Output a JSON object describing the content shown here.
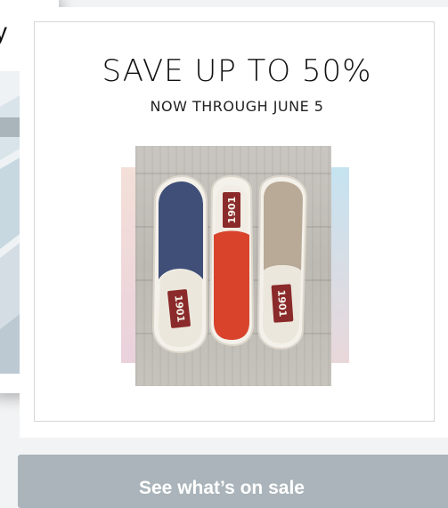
{
  "carousel": {
    "prev_card": {
      "text_fragment": "y"
    },
    "promo": {
      "headline": "SAVE UP TO 50%",
      "subhead": "NOW THROUGH JUNE 5",
      "image": {
        "subject": "three slip-on sneakers",
        "brand_mark": "1901",
        "shoe_colors": [
          "#3f4f78",
          "#d9432c",
          "#b8aa96"
        ]
      }
    }
  },
  "cta": {
    "label": "See what’s on sale"
  },
  "colors": {
    "page_background": "#f2f3f4",
    "card_background": "#ffffff",
    "cta_background": "#aab4ba",
    "cta_text": "#ffffff"
  }
}
